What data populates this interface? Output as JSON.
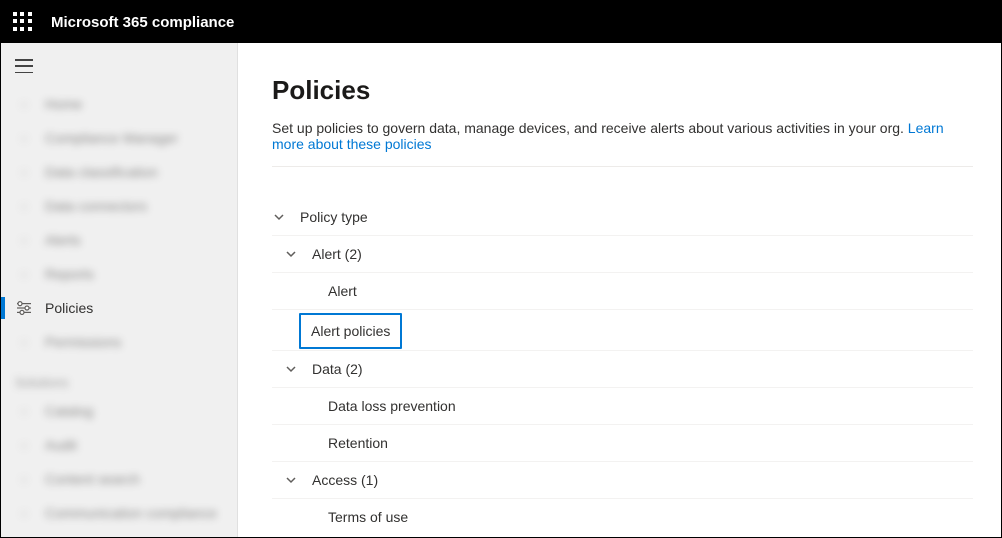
{
  "header": {
    "title": "Microsoft 365 compliance"
  },
  "sidebar": {
    "items": [
      {
        "label": "Home"
      },
      {
        "label": "Compliance Manager"
      },
      {
        "label": "Data classification"
      },
      {
        "label": "Data connectors"
      },
      {
        "label": "Alerts"
      },
      {
        "label": "Reports"
      },
      {
        "label": "Policies"
      },
      {
        "label": "Permissions"
      }
    ],
    "section_label": "Solutions",
    "solutions": [
      {
        "label": "Catalog"
      },
      {
        "label": "Audit"
      },
      {
        "label": "Content search"
      },
      {
        "label": "Communication compliance"
      }
    ]
  },
  "page": {
    "title": "Policies",
    "description": "Set up policies to govern data, manage devices, and receive alerts about various activities in your org. ",
    "link_text": "Learn more about these policies"
  },
  "tree": {
    "root": "Policy type",
    "groups": [
      {
        "label": "Alert (2)",
        "children": [
          "Alert",
          "Alert policies"
        ],
        "highlighted_index": 1
      },
      {
        "label": "Data (2)",
        "children": [
          "Data loss prevention",
          "Retention"
        ]
      },
      {
        "label": "Access (1)",
        "children": [
          "Terms of use"
        ]
      }
    ]
  }
}
